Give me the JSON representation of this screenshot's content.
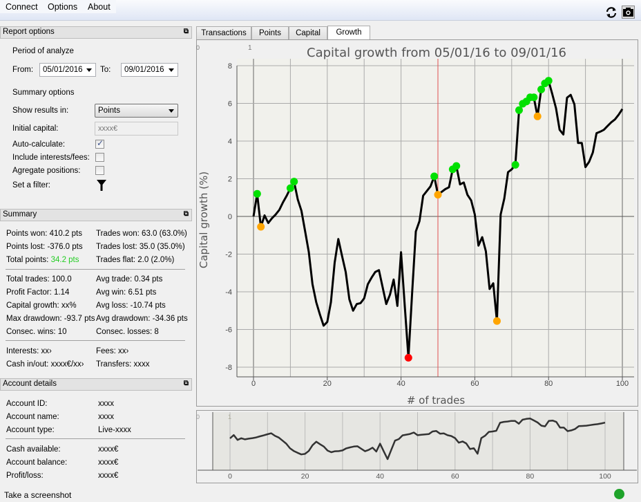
{
  "menu": {
    "items": [
      "Connect",
      "Options",
      "About"
    ]
  },
  "toolbar": {
    "refresh_icon": "refresh-icon",
    "camera_icon": "camera-icon"
  },
  "report_options": {
    "title": "Report options",
    "period_label": "Period of analyze",
    "from_label": "From:",
    "from_value": "05/01/2016",
    "to_label": "To:",
    "to_value": "09/01/2016",
    "summary_options_label": "Summary options",
    "show_results_label": "Show results in:",
    "show_results_value": "Points",
    "initial_capital_label": "Initial capital:",
    "initial_capital_placeholder": "xxxx€",
    "auto_calc_label": "Auto-calculate:",
    "auto_calc_checked": true,
    "include_fees_label": "Include interests/fees:",
    "include_fees_checked": false,
    "aggregate_label": "Agregate positions:",
    "aggregate_checked": false,
    "filter_label": "Set a filter:"
  },
  "summary": {
    "title": "Summary",
    "points_won": "Points won: 410.2 pts",
    "points_lost": "Points lost: -376.0 pts",
    "total_points_label": "Total points:",
    "total_points_value": "34.2 pts",
    "trades_won": "Trades won: 63.0 (63.0%)",
    "trades_lost": "Trades lost: 35.0 (35.0%)",
    "trades_flat": "Trades flat: 2.0 (2.0%)",
    "total_trades": "Total trades: 100.0",
    "profit_factor": "Profit Factor: 1.14",
    "capital_growth": "Capital growth: xx%",
    "max_drawdown": "Max drawdown: -93.7 pts",
    "consec_wins": "Consec. wins: 10",
    "avg_trade": "Avg trade: 0.34 pts",
    "avg_win": "Avg win: 6.51 pts",
    "avg_loss": "Avg loss: -10.74 pts",
    "avg_drawdown": "Avg drawdown: -34.36 pts",
    "consec_losses": "Consec. losses: 8",
    "interests": "Interests: xx›",
    "cash_in_out": "Cash in/out: xxxx€/xx›",
    "fees": "Fees: xx›",
    "transfers": "Transfers: xxxx",
    "positive_color": "#22cc22"
  },
  "account": {
    "title": "Account details",
    "rows": [
      {
        "label": "Account ID:",
        "value": "xxxx"
      },
      {
        "label": "Account name:",
        "value": "xxxx"
      },
      {
        "label": "Account type:",
        "value": "Live-xxxx"
      },
      {
        "label": "Cash available:",
        "value": "xxxx€"
      },
      {
        "label": "Account balance:",
        "value": "xxxx€"
      },
      {
        "label": "Profit/loss:",
        "value": "xxxx€"
      }
    ]
  },
  "status": {
    "text": "Take a screenshot",
    "indicator_color": "#1fa32a"
  },
  "tabs": [
    {
      "label": "Transactions",
      "active": false
    },
    {
      "label": "Points",
      "active": false
    },
    {
      "label": "Capital",
      "active": false
    },
    {
      "label": "Growth",
      "active": true
    }
  ],
  "chart_corner_labels": [
    "0",
    "1"
  ],
  "chart_data": {
    "type": "line",
    "title": "Capital growth from 05/01/16 to 09/01/16",
    "xlabel": "# of trades",
    "ylabel": "Capital growth (%)",
    "xlim": [
      -5,
      105
    ],
    "ylim": [
      -8.5,
      8.5
    ],
    "xticks": [
      0,
      20,
      40,
      60,
      80,
      100
    ],
    "yticks": [
      -8,
      -6,
      -4,
      -2,
      0,
      2,
      4,
      6,
      8
    ],
    "grid": true,
    "x": [
      0,
      1,
      2,
      3,
      4,
      5,
      6,
      7,
      8,
      9,
      10,
      11,
      12,
      13,
      14,
      15,
      16,
      17,
      18,
      19,
      20,
      21,
      22,
      23,
      24,
      25,
      26,
      27,
      28,
      29,
      30,
      31,
      32,
      33,
      34,
      35,
      36,
      37,
      38,
      39,
      40,
      41,
      42,
      43,
      44,
      45,
      46,
      47,
      48,
      49,
      50,
      51,
      52,
      53,
      54,
      55,
      56,
      57,
      58,
      59,
      60,
      61,
      62,
      63,
      64,
      65,
      66,
      67,
      68,
      69,
      70,
      71,
      72,
      73,
      74,
      75,
      76,
      77,
      78,
      79,
      80,
      81,
      82,
      83,
      84,
      85,
      86,
      87,
      88,
      89,
      90,
      91,
      92,
      93,
      94,
      95,
      96,
      97,
      98,
      99,
      100
    ],
    "y": [
      0,
      1.2,
      -0.55,
      0.05,
      -0.35,
      -0.1,
      0.1,
      0.35,
      0.75,
      1.1,
      1.5,
      1.85,
      0.9,
      0.3,
      -0.8,
      -1.9,
      -3.6,
      -4.55,
      -5.2,
      -5.8,
      -5.6,
      -4.55,
      -2.45,
      -1.2,
      -2.1,
      -2.95,
      -4.4,
      -5.0,
      -4.65,
      -4.6,
      -4.35,
      -3.6,
      -3.25,
      -2.95,
      -2.85,
      -3.75,
      -4.65,
      -4.15,
      -3.35,
      -4.75,
      -1.9,
      -4.7,
      -7.5,
      -4.1,
      -0.8,
      -0.25,
      1.1,
      1.35,
      1.6,
      2.13,
      1.15,
      1.3,
      1.45,
      1.55,
      2.5,
      2.68,
      1.7,
      1.8,
      1.15,
      0.85,
      0.1,
      -1.55,
      -1.1,
      -1.85,
      -3.85,
      -3.55,
      -5.55,
      0.1,
      0.95,
      2.35,
      2.5,
      2.74,
      5.64,
      5.98,
      6.1,
      6.32,
      6.32,
      5.31,
      6.74,
      7.06,
      7.2,
      6.5,
      5.75,
      4.6,
      4.35,
      6.3,
      6.45,
      5.95,
      3.9,
      3.9,
      2.62,
      2.9,
      3.4,
      4.42,
      4.5,
      4.6,
      4.8,
      5.0,
      5.15,
      5.4,
      5.7
    ],
    "markers": {
      "new_high": {
        "color": "#00e000",
        "x": [
          1,
          10,
          11,
          49,
          54,
          55,
          71,
          72,
          73,
          74,
          75,
          76,
          78,
          79,
          80
        ]
      },
      "drawdown_low": {
        "color": "#ffa500",
        "x": [
          2,
          50,
          66,
          77
        ]
      },
      "max_drawdown": {
        "color": "#ff0000",
        "x": [
          42
        ]
      }
    },
    "cursor_x": 50,
    "cursor_color": "#e05050",
    "navigator": {
      "xticks": [
        0,
        20,
        40,
        60,
        80,
        100
      ]
    }
  }
}
